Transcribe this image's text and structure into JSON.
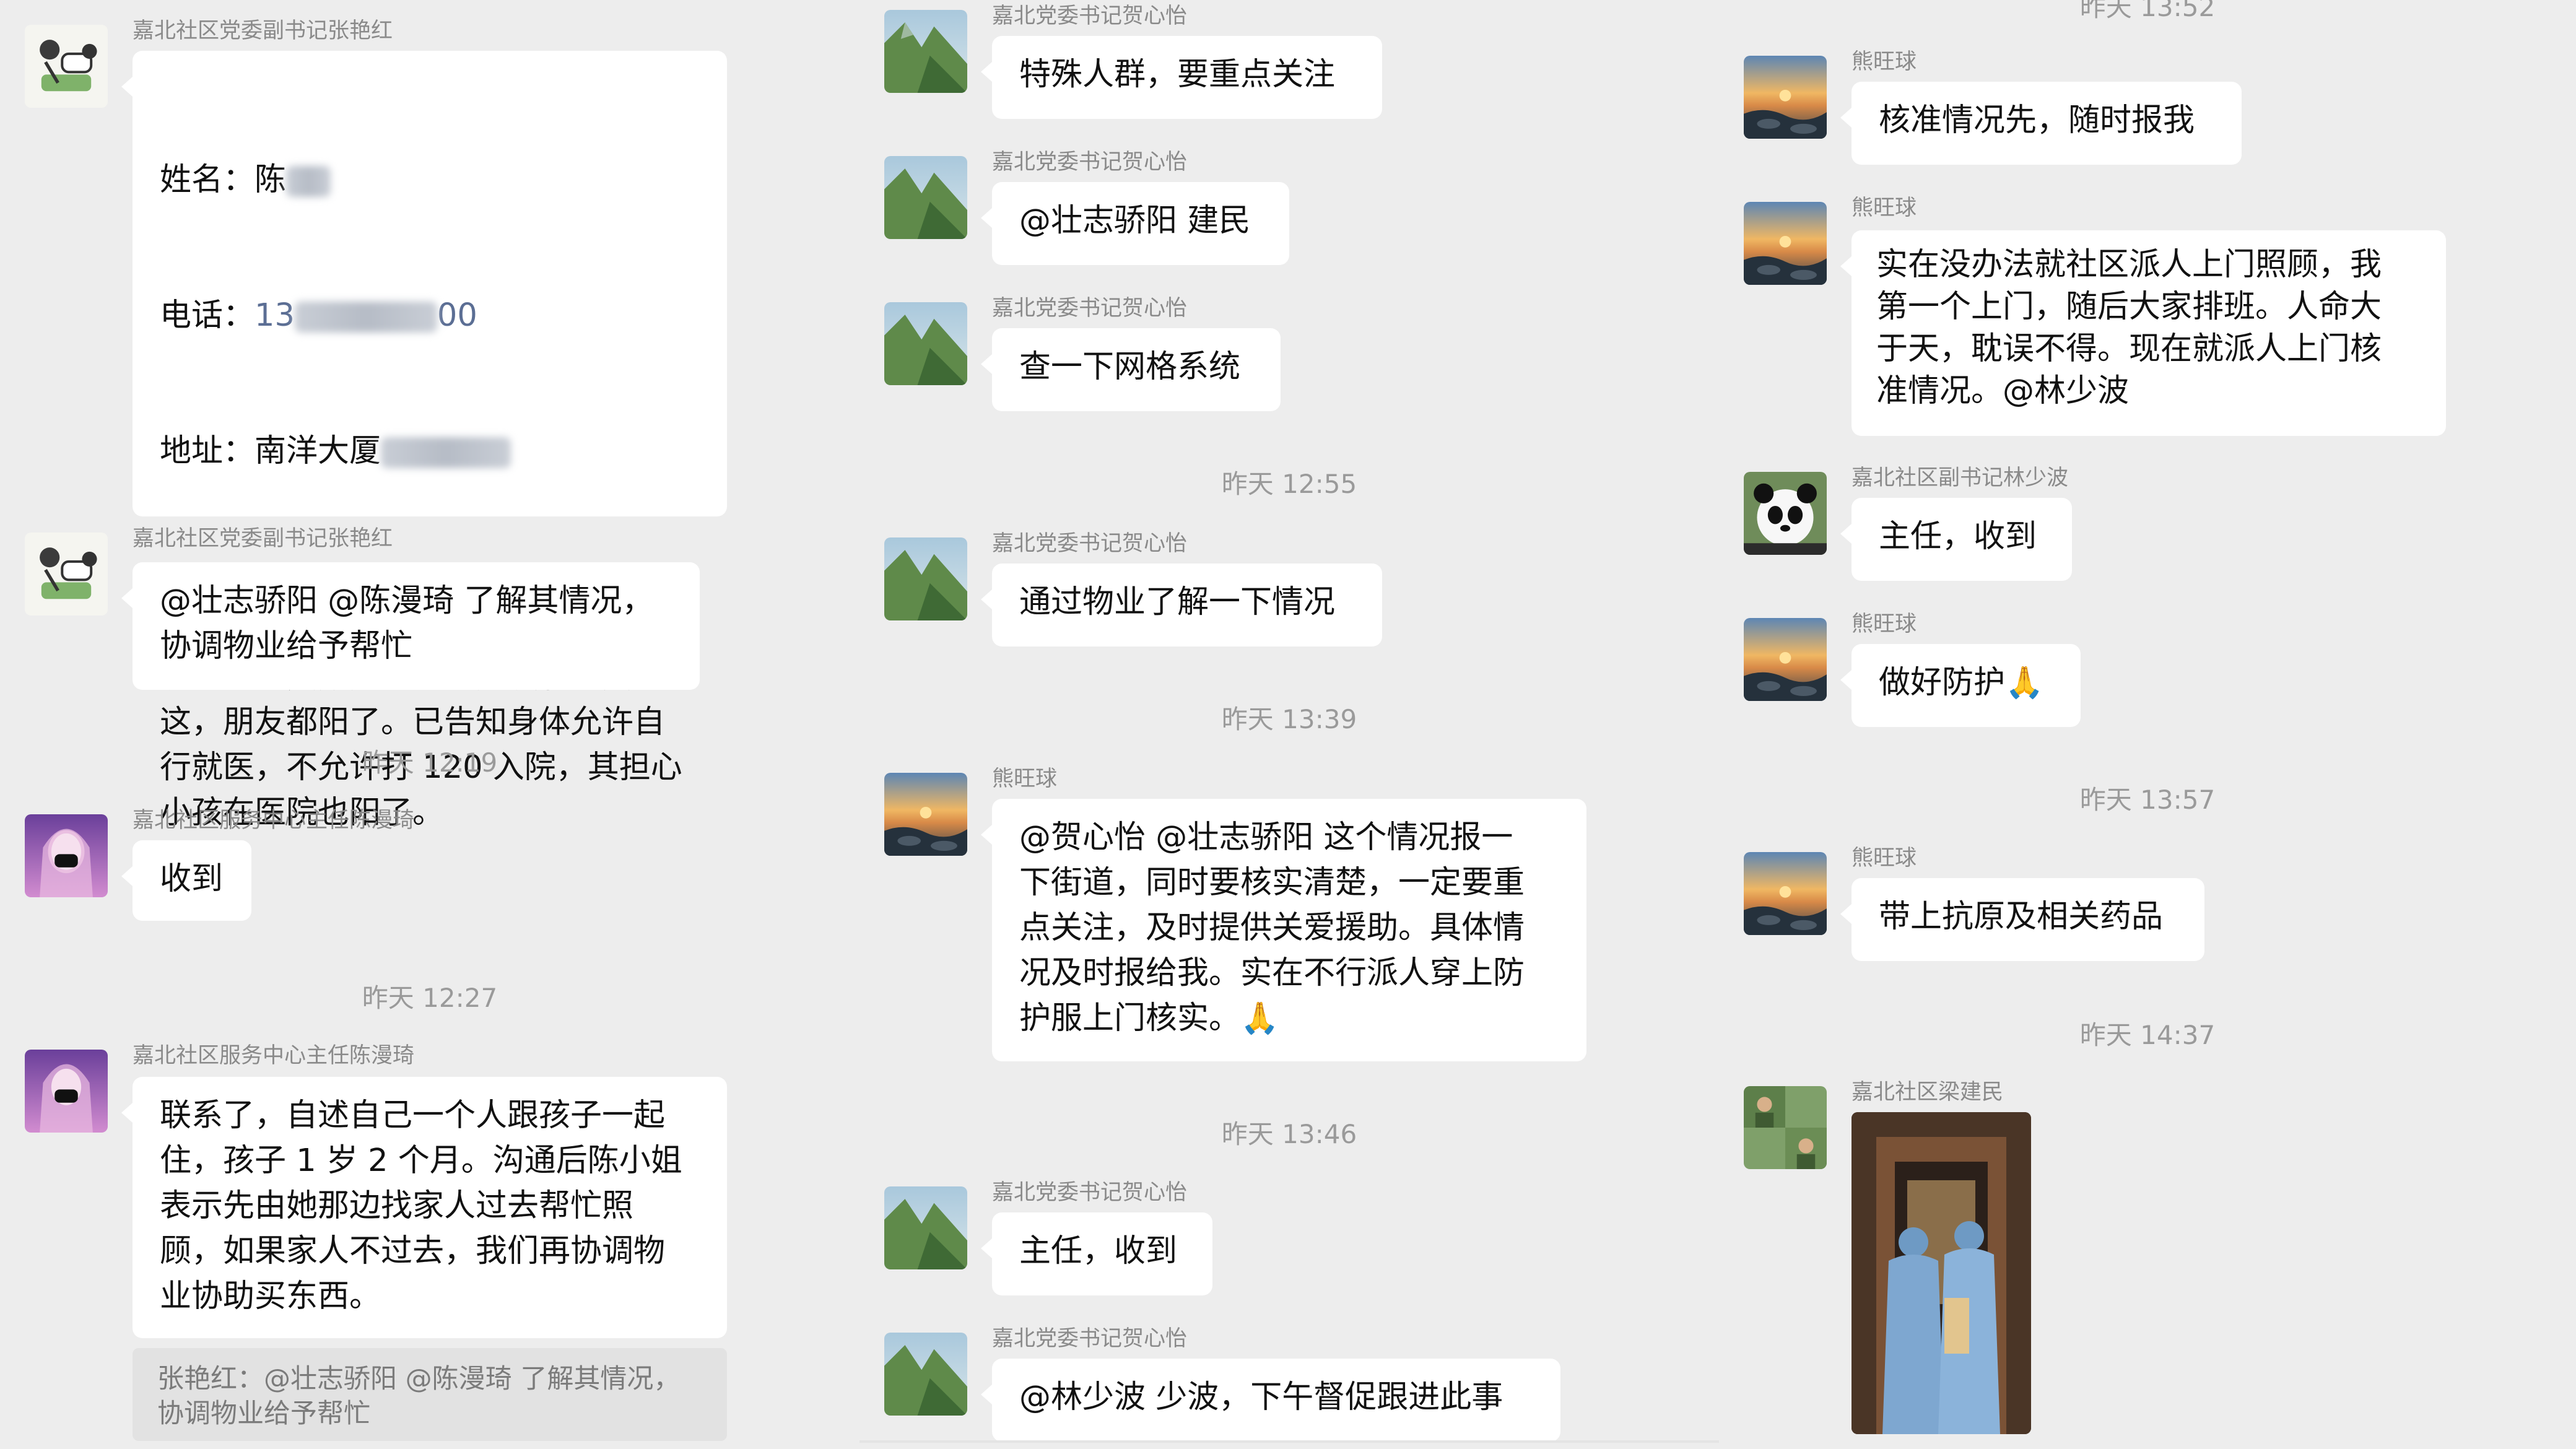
{
  "colors": {
    "panel_bg": "#ededed",
    "bubble_bg": "#ffffff",
    "meta_text": "#8a8a8a",
    "link": "#5b6e94"
  },
  "icons": [
    "cartoon-avatar-icon",
    "pink-mask-avatar-icon",
    "mountain-avatar-icon",
    "sunset-rocks-avatar-icon",
    "panda-avatar-icon",
    "group-photo-avatar-icon",
    "raised-hands-emoji"
  ],
  "panel1": {
    "msg1": {
      "sender": "嘉北社区党委副书记张艳红",
      "name_label": "姓名：",
      "name_value": "陈",
      "phone_label": "电话：",
      "phone_value_start": "13",
      "phone_value_end": "00",
      "address_label": "地址：",
      "address_value": "南洋大厦",
      "request_text": "诉求：自己确诊了，起床都困难，还\n有个需要喂奶的宝宝，诉求是希望能\n派个人去照顾她宝宝。她没有亲戚在\n这，朋友都阳了。已告知身体允许自\n行就医，不允许打 120 入院，其担心\n小孩在医院也阳了。"
    },
    "msg2": {
      "sender": "嘉北社区党委副书记张艳红",
      "text": "@壮志骄阳 @陈漫琦 了解其情况，\n协调物业给予帮忙"
    },
    "time1": "昨天 12:19",
    "msg3": {
      "sender": "嘉北社区服务中心主任陈漫琦",
      "text": "收到"
    },
    "time2": "昨天 12:27",
    "msg4": {
      "sender": "嘉北社区服务中心主任陈漫琦",
      "text": "联系了，自述自己一个人跟孩子一起\n住，孩子 1 岁 2 个月。沟通后陈小姐\n表示先由她那边找家人过去帮忙照\n顾，如果家人不过去，我们再协调物\n业协助买东西。"
    },
    "quote": "张艳红：@壮志骄阳 @陈漫琦 了解其情况，\n协调物业给予帮忙"
  },
  "panel2": {
    "msg1": {
      "sender": "嘉北党委书记贺心怡",
      "text": "特殊人群，要重点关注"
    },
    "msg2": {
      "sender": "嘉北党委书记贺心怡",
      "text": "@壮志骄阳 建民"
    },
    "msg3": {
      "sender": "嘉北党委书记贺心怡",
      "text": "查一下网格系统"
    },
    "time1": "昨天 12:55",
    "msg4": {
      "sender": "嘉北党委书记贺心怡",
      "text": "通过物业了解一下情况"
    },
    "time2": "昨天 13:39",
    "msg5": {
      "sender": "熊旺球",
      "text": "@贺心怡 @壮志骄阳 这个情况报一\n下街道，同时要核实清楚，一定要重\n点关注，及时提供关爱援助。具体情\n况及时报给我。实在不行派人穿上防\n护服上门核实。"
    },
    "time3": "昨天 13:46",
    "msg6": {
      "sender": "嘉北党委书记贺心怡",
      "text": "主任，收到"
    },
    "msg7": {
      "sender": "嘉北党委书记贺心怡",
      "text": "@林少波 少波，下午督促跟进此事"
    }
  },
  "panel3": {
    "time0": "昨天 13:52",
    "msg1": {
      "sender": "熊旺球",
      "text": "核准情况先，随时报我"
    },
    "msg2": {
      "sender": "熊旺球",
      "text": "实在没办法就社区派人上门照顾，我\n第一个上门，随后大家排班。人命大\n于天，耽误不得。现在就派人上门核\n准情况。@林少波"
    },
    "msg3": {
      "sender": "嘉北社区副书记林少波",
      "text": "主任，收到"
    },
    "msg4": {
      "sender": "熊旺球",
      "text": "做好防护"
    },
    "time1": "昨天 13:57",
    "msg5": {
      "sender": "熊旺球",
      "text": "带上抗原及相关药品"
    },
    "time2": "昨天 14:37",
    "msg6": {
      "sender": "嘉北社区梁建民"
    }
  }
}
